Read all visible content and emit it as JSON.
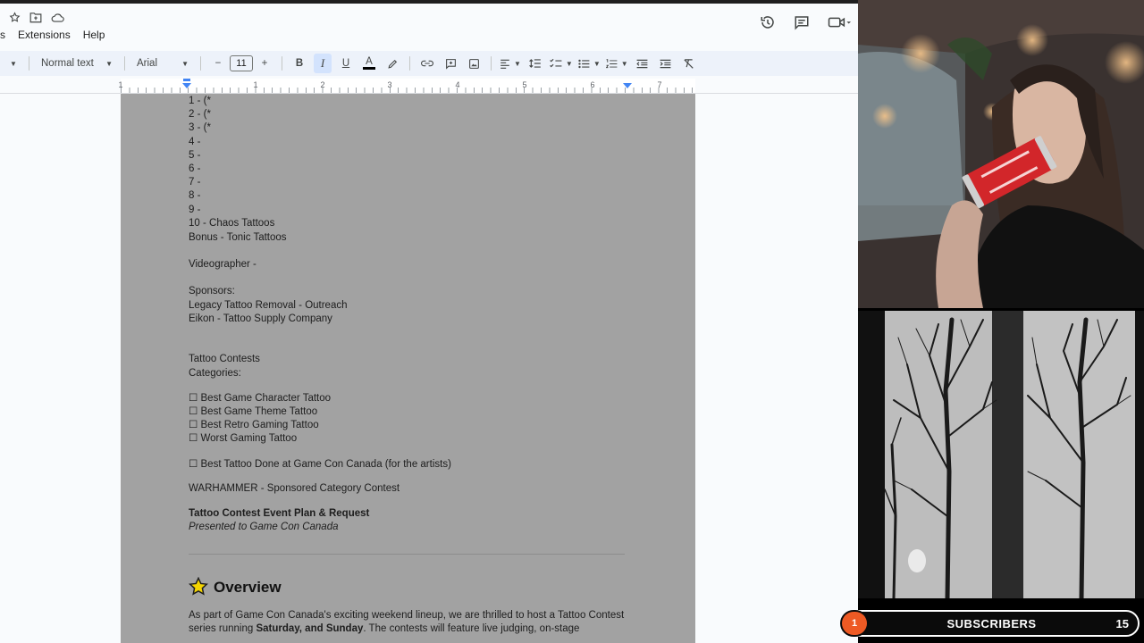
{
  "menu": {
    "partial_item": "s",
    "extensions": "Extensions",
    "help": "Help"
  },
  "toolbar": {
    "style": "Normal text",
    "font": "Arial",
    "font_size": "11",
    "minus": "−",
    "plus": "+",
    "bold": "B",
    "italic": "I",
    "underline": "U",
    "text_color": "A"
  },
  "ruler": {
    "numbers": [
      "1",
      "1",
      "2",
      "3",
      "4",
      "5",
      "6",
      "7"
    ]
  },
  "document": {
    "list": [
      "1 - (*",
      "2 - (*",
      "3 - (*",
      "4 -",
      "5 -",
      "6 -",
      "7 -",
      "8 -",
      "9 -",
      "10 - Chaos Tattoos",
      "Bonus - Tonic Tattoos"
    ],
    "videographer": "Videographer -",
    "sponsors_heading": "Sponsors:",
    "sponsor_1": "Legacy Tattoo Removal - Outreach",
    "sponsor_2": "Eikon - Tattoo Supply Company",
    "contests_heading": "Tattoo Contests",
    "categories_heading": "Categories:",
    "categories": [
      "☐ Best Game Character Tattoo",
      "☐ Best Game Theme Tattoo",
      "☐ Best Retro Gaming Tattoo",
      "☐ Worst Gaming Tattoo"
    ],
    "artist_category": "☐ Best Tattoo Done at Game Con Canada (for the artists)",
    "warhammer": "WARHAMMER - Sponsored Category Contest",
    "plan_title": "Tattoo Contest Event Plan & Request",
    "plan_subtitle": "Presented to Game Con Canada",
    "overview_heading": "Overview",
    "overview_p1": "As part of Game Con Canada's exciting weekend lineup, we are thrilled to host a Tattoo Contest",
    "overview_p2_pre": "series running ",
    "overview_p2_bold": "Saturday, and Sunday",
    "overview_p2_post": ". The contests will feature live judging, on-stage"
  },
  "subscribers": {
    "badge": "1",
    "label": "SUBSCRIBERS",
    "count": "15"
  },
  "colors": {
    "accent": "#ee5a24",
    "page_bg": "#a2a2a2",
    "toolbar_bg": "#edf2fa"
  }
}
